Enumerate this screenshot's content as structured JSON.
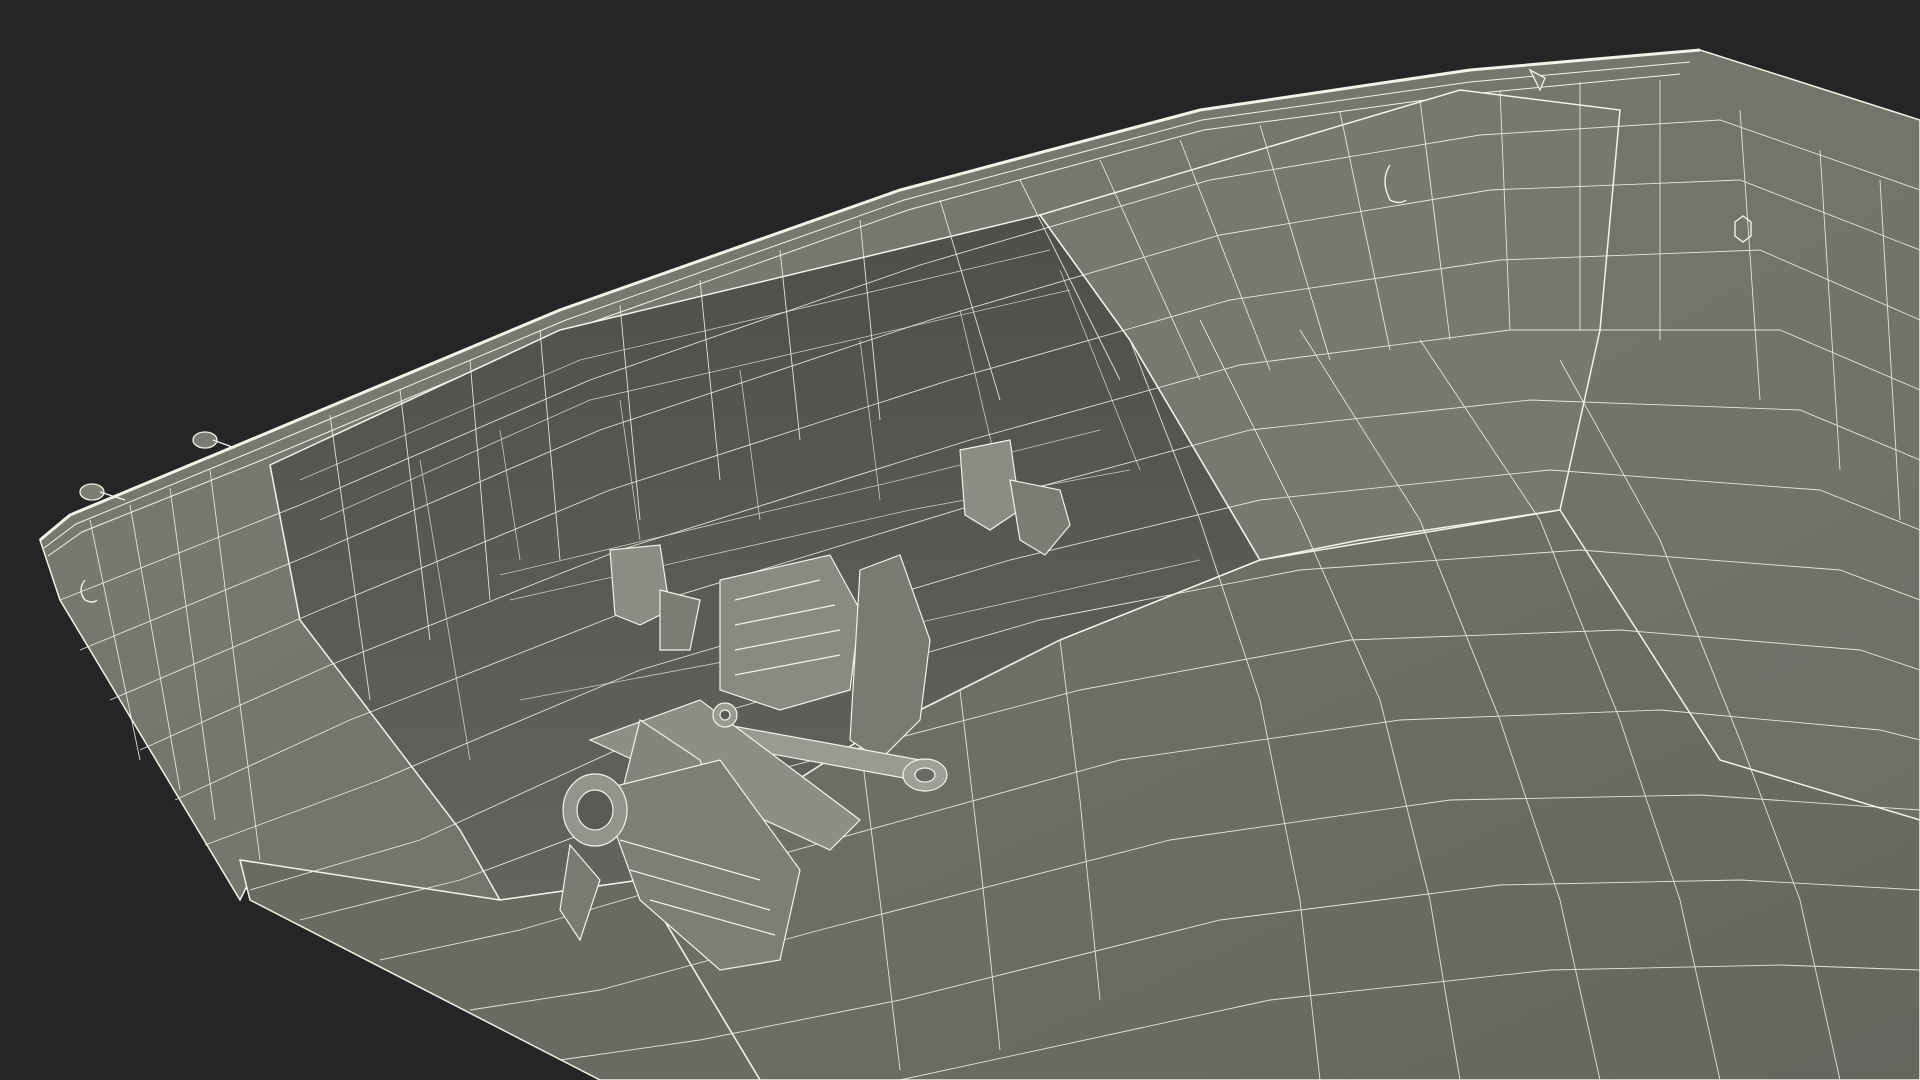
{
  "scene": {
    "colors": {
      "background": "#252525",
      "hull_light": "#7a7a72",
      "hull_mid": "#6c6c65",
      "hull_dark": "#55554f",
      "wire": "#f2f2e8",
      "engine": "#8a8a82"
    }
  }
}
